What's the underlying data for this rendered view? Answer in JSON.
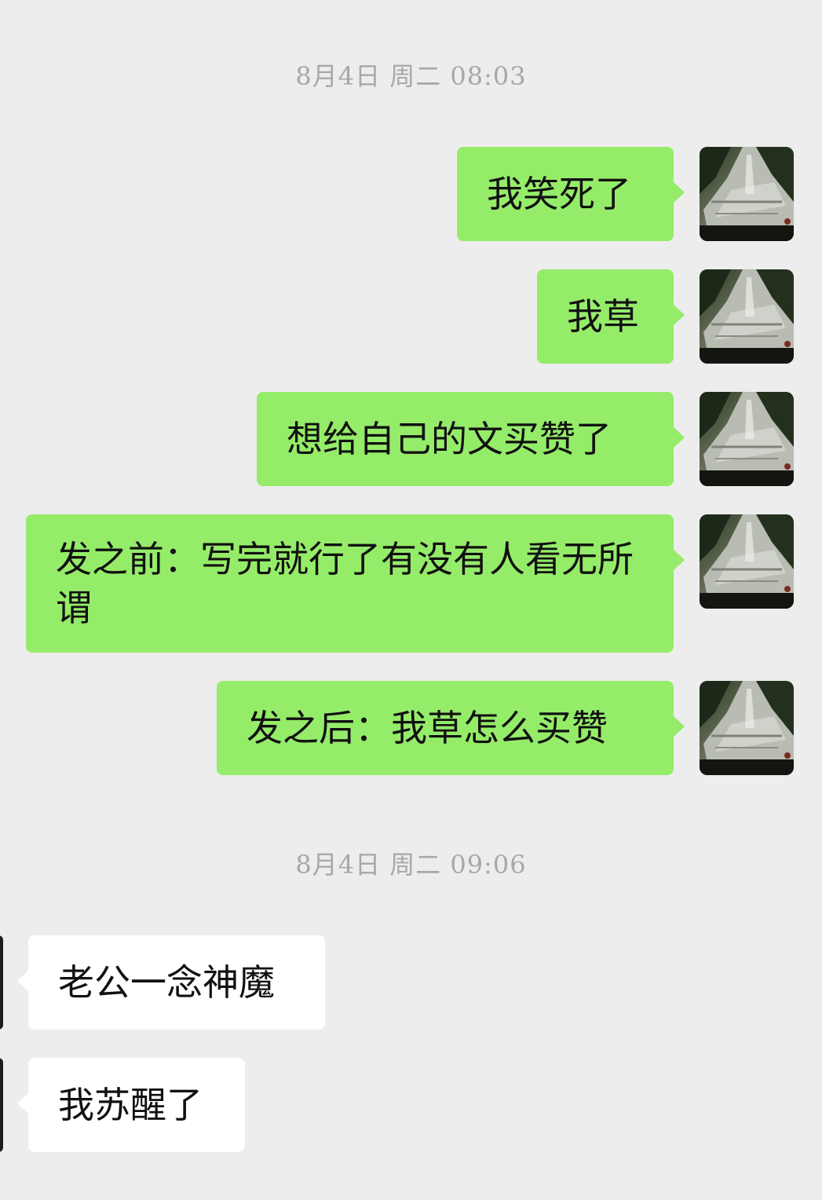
{
  "timestamps": {
    "first": "8月4日  周二  08:03",
    "second": "8月4日  周二  09:06"
  },
  "messages": {
    "out": [
      "我笑死了",
      "我草",
      "想给自己的文买赞了",
      "发之前：写完就行了有没有人看无所谓",
      "发之后：我草怎么买赞"
    ],
    "in": [
      "老公一念神魔",
      "我苏醒了"
    ]
  },
  "colors": {
    "background": "#ededed",
    "outgoing_bubble": "#95ec69",
    "incoming_bubble": "#ffffff",
    "timestamp_text": "#a8a8a8"
  },
  "icons": {
    "sender_avatar": "avatar-photo-icon",
    "receiver_avatar": "avatar-photo-icon"
  }
}
